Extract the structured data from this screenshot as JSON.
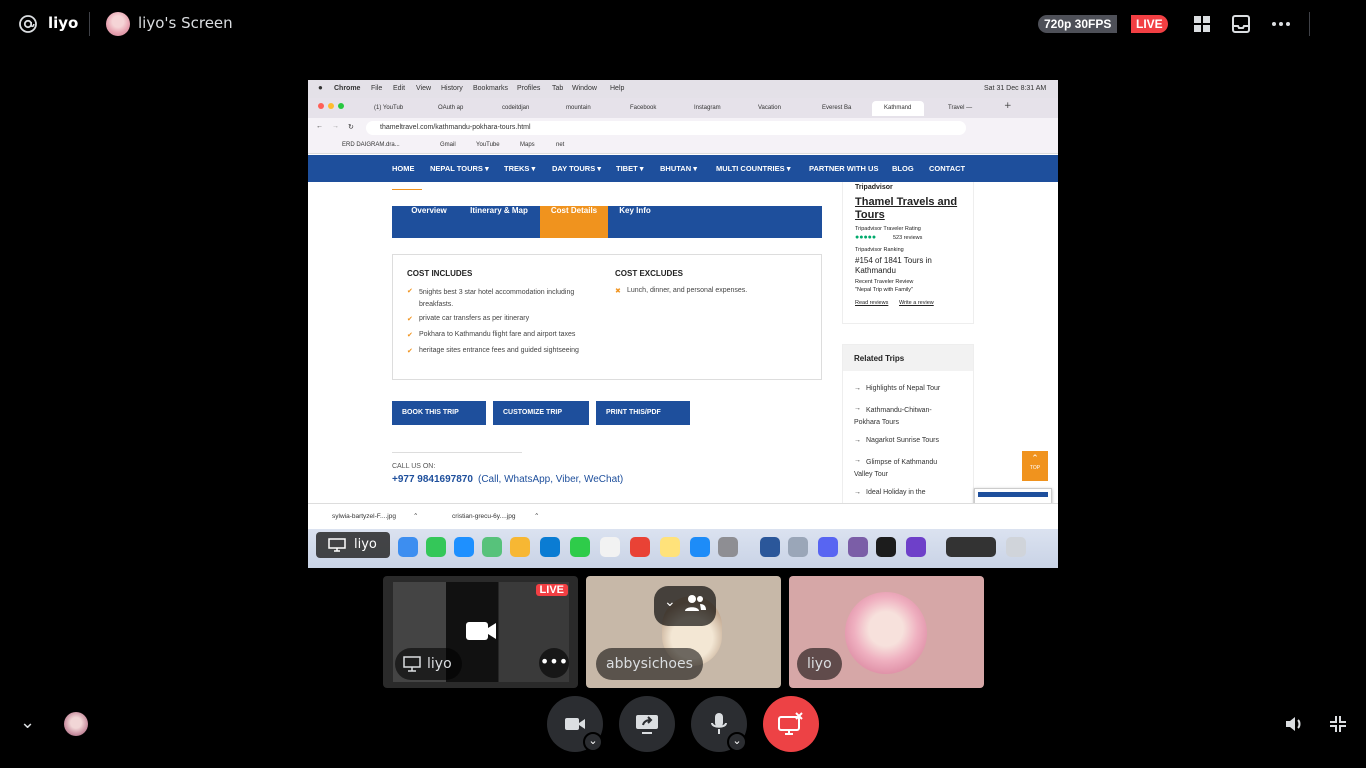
{
  "topbar": {
    "server_name": "liyo",
    "screen_title": "liyo's Screen",
    "quality_badge": "720p 30FPS",
    "live_badge": "LIVE"
  },
  "shared_screen": {
    "mac_menubar": [
      "Chrome",
      "File",
      "Edit",
      "View",
      "History",
      "Bookmarks",
      "Profiles",
      "Tab",
      "Window",
      "Help"
    ],
    "clock": "Sat 31 Dec  8:31 AM",
    "tabs": [
      "(1) YouTub",
      "OAuth ap",
      "codeitdjan",
      "mountain",
      "Facebook",
      "Instagram",
      "Vacation",
      "Everest Ba",
      "Kathmand",
      "Travel — "
    ],
    "url": "thameltravel.com/kathmandu-pokhara-tours.html",
    "bookmarks": [
      "ERD DAIGRAM.dra...",
      "Gmail",
      "YouTube",
      "Maps",
      "net"
    ],
    "site_nav": [
      "HOME",
      "NEPAL TOURS ▾",
      "TREKS ▾",
      "DAY TOURS ▾",
      "TIBET ▾",
      "BHUTAN ▾",
      "MULTI COUNTRIES ▾",
      "PARTNER WITH US",
      "BLOG",
      "CONTACT"
    ],
    "content_tabs": [
      "Overview",
      "Itinerary & Map",
      "Cost Details",
      "Key Info"
    ],
    "cost_includes_title": "COST INCLUDES",
    "cost_includes": [
      "5nights best 3 star hotel accommodation including breakfasts.",
      "private car transfers as per itinerary",
      "Pokhara to Kathmandu flight fare and airport taxes",
      "heritage sites entrance fees and guided sightseeing"
    ],
    "cost_excludes_title": "COST EXCLUDES",
    "cost_excludes": [
      "Lunch, dinner, and personal expenses."
    ],
    "buttons": [
      "BOOK THIS TRIP",
      "CUSTOMIZE TRIP",
      "PRINT THIS/PDF"
    ],
    "call_label": "CALL US ON:",
    "phone": "+977 9841697870",
    "phone_note": "(Call, WhatsApp, Viber, WeChat)",
    "tripadvisor": {
      "brand": "Tripadvisor",
      "name": "Thamel Travels and Tours",
      "rating_label": "Tripadvisor Traveler Rating",
      "reviews": "523 reviews",
      "ranking_label": "Tripadvisor Ranking",
      "ranking": "#154 of 1841 Tours in Kathmandu",
      "recent_label": "Recent Traveler Review",
      "recent_review": "\"Nepal Trip with Family\"",
      "read_reviews": "Read reviews",
      "write_review": "Write a review"
    },
    "related_title": "Related Trips",
    "related_trips": [
      "Highlights of Nepal Tour",
      "Kathmandu-Chitwan-Pokhara Tours",
      "Nagarkot Sunrise Tours",
      "Glimpse of Kathmandu Valley Tour",
      "Ideal Holiday in the"
    ],
    "top_label": "TOP",
    "downloads": [
      "sylwia-bartyzel-F....jpg",
      "cristian-grecu-6y....jpg"
    ],
    "dock_label": "liyo"
  },
  "tiles": [
    {
      "name": "liyo",
      "live": "LIVE"
    },
    {
      "name": "abbysichoes"
    },
    {
      "name": "liyo"
    }
  ],
  "colors": {
    "live_red": "#f23f43",
    "site_blue": "#1e4f9c",
    "site_orange": "#f0931e",
    "disconnect_red": "#ed4245"
  }
}
